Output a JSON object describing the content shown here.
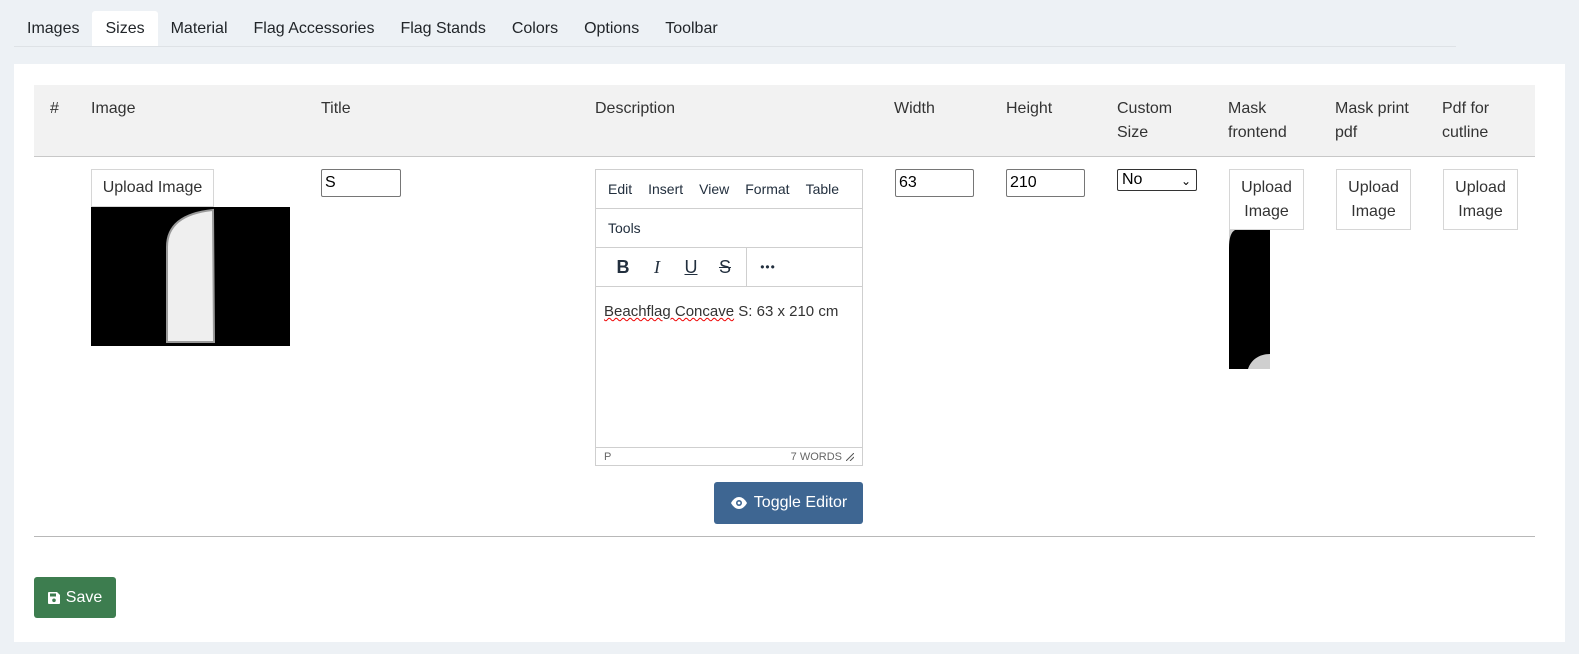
{
  "tabs": [
    {
      "label": "Images",
      "active": false
    },
    {
      "label": "Sizes",
      "active": true
    },
    {
      "label": "Material",
      "active": false
    },
    {
      "label": "Flag Accessories",
      "active": false
    },
    {
      "label": "Flag Stands",
      "active": false
    },
    {
      "label": "Colors",
      "active": false
    },
    {
      "label": "Options",
      "active": false
    },
    {
      "label": "Toolbar",
      "active": false
    }
  ],
  "table": {
    "headers": {
      "num": "#",
      "image": "Image",
      "title": "Title",
      "description": "Description",
      "width": "Width",
      "height": "Height",
      "custom_size_1": "Custom",
      "custom_size_2": "Size",
      "mask_frontend_1": "Mask",
      "mask_frontend_2": "frontend",
      "mask_print_1": "Mask print",
      "mask_print_2": "pdf",
      "pdf_cutline_1": "Pdf for",
      "pdf_cutline_2": "cutline"
    },
    "row": {
      "upload_image_label": "Upload Image",
      "title_value": "S",
      "width_value": "63",
      "height_value": "210",
      "custom_size_value": "No",
      "upload_1": "Upload",
      "upload_2": "Image"
    }
  },
  "editor": {
    "menu": [
      "Edit",
      "Insert",
      "View",
      "Format",
      "Table"
    ],
    "menu2": "Tools",
    "tools": {
      "bold": "B",
      "italic": "I",
      "underline": "U",
      "strike": "S",
      "more": "•••"
    },
    "content_spell": "Beachflag Concave",
    "content_rest": " S: 63 x 210 cm",
    "status_path": "P",
    "status_words": "7 WORDS"
  },
  "buttons": {
    "toggle_editor": "Toggle Editor",
    "save": "Save"
  },
  "icons": {
    "toggle": "eye-icon",
    "save": "floppy-disk-icon"
  }
}
